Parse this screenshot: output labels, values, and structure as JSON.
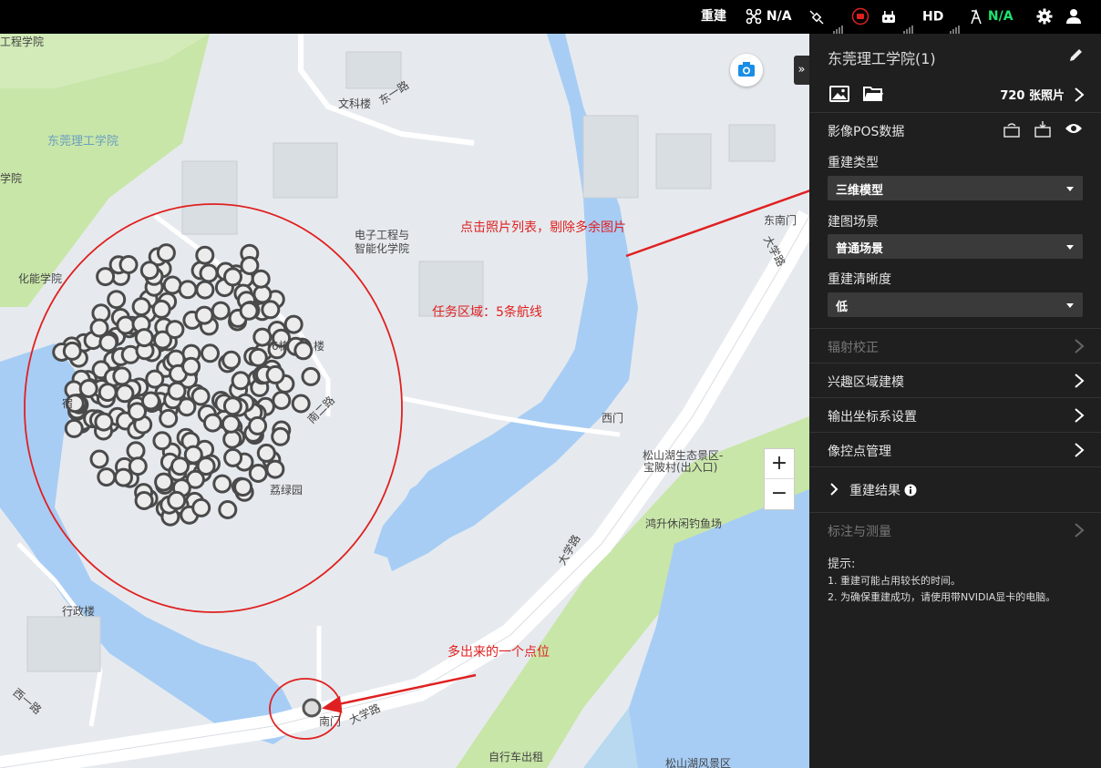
{
  "topbar": {
    "reconstruct": "重建",
    "drone_status": "N/A",
    "hd_label": "HD",
    "rtk_status": "N/A",
    "icons": [
      "drone-icon",
      "satellite-icon",
      "record-icon",
      "controller-icon",
      "rtk-icon",
      "gear-icon",
      "user-icon"
    ]
  },
  "map": {
    "labels": {
      "school_corner": "工程学院",
      "dongguan": "东莞理工学院",
      "wenke": "文科楼",
      "dongyilu": "东一路",
      "xueyuan": "学院",
      "huaneng": "化能学院",
      "dianzi1": "电子工程与",
      "dianzi2": "智能化学院",
      "dongnanmen": "东南门",
      "daxuelu_ne": "大学路",
      "building6": "6栋",
      "lou": "楼",
      "nanerlu": "南二路",
      "xuan": "宿",
      "ximen": "西门",
      "songshanhu1": "松山湖生态景区-",
      "songshanhu2": "宝陂村(出入口)",
      "lvyuan": "荔绿园",
      "hongsheng": "鸿升休闲钓鱼场",
      "daxuelu_mid": "大学路",
      "xingzheng": "行政楼",
      "xiyilu": "西一路",
      "nanmen": "南门",
      "daxuelu_s": "大学路",
      "bike": "自行车出租",
      "songshanhu_scenic": "松山湖风景区"
    },
    "annotations": {
      "photo_list": "点击照片列表，剔除多余图片",
      "task_area": "任务区域：5条航线",
      "extra_point": "多出来的一个点位"
    },
    "zoom_in": "+",
    "zoom_out": "−",
    "collapse": "»"
  },
  "panel": {
    "title": "东莞理工学院(1)",
    "photo_count": "720 张照片",
    "pos_label": "影像POS数据",
    "recon_type_label": "重建类型",
    "recon_type_value": "三维模型",
    "scene_label": "建图场景",
    "scene_value": "普通场景",
    "clarity_label": "重建清晰度",
    "clarity_value": "低",
    "radiometric": "辐射校正",
    "roi": "兴趣区域建模",
    "coord_system": "输出坐标系设置",
    "gcp": "像控点管理",
    "result": "重建结果",
    "annotate": "标注与测量",
    "tips_title": "提示:",
    "tip1": "1. 重建可能占用较长的时间。",
    "tip2": "2. 为确保重建成功，请使用带NVIDIA显卡的电脑。"
  },
  "colors": {
    "topbar_bg": "#000000",
    "panel_bg": "#1f1f1f",
    "water": "#a7cdf5",
    "green_area": "#c8e6a8",
    "annotation_red": "#e02020",
    "status_green": "#1fe36e"
  }
}
